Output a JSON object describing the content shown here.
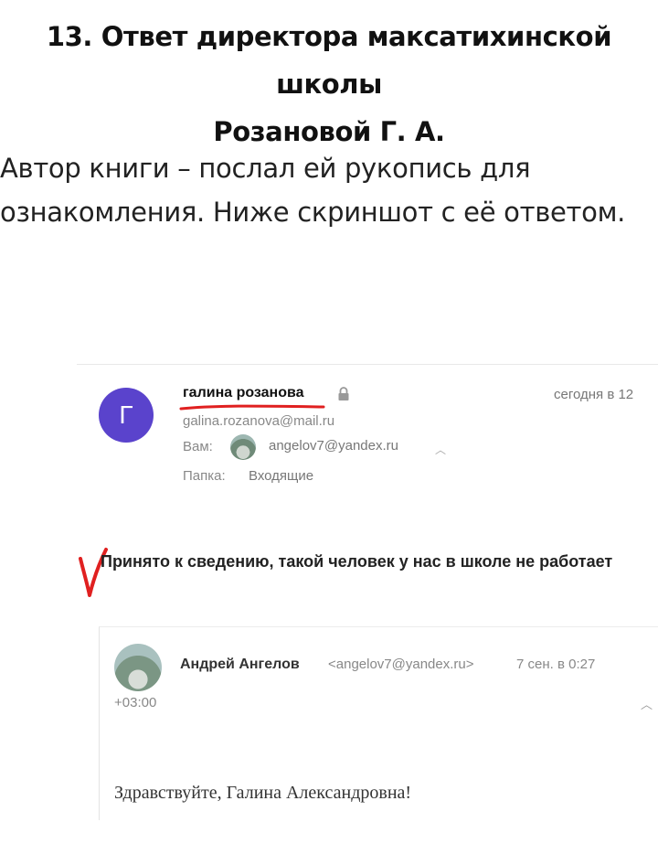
{
  "article": {
    "title_line1": "13. Ответ директора максатихинской школы",
    "title_line2": "Розановой Г. А.",
    "intro_line1": "Автор книги – послал ей рукопись для",
    "intro_line2": "ознакомления. Ниже скриншот с её ответом."
  },
  "email": {
    "avatar_letter": "Г",
    "avatar_color": "#5a43cc",
    "sender_name": "галина розанова",
    "sender_email": "galina.rozanova@mail.ru",
    "date": "сегодня в 12",
    "to_label": "Вам:",
    "to_email": "angelov7@yandex.ru",
    "folder_label": "Папка:",
    "folder_value": "Входящие",
    "reply_text": "Принято к сведению, такой человек у нас в школе не работает",
    "annotation_color": "#e02020",
    "icons": [
      "lock-icon",
      "chevron-up-icon"
    ]
  },
  "quoted": {
    "name": "Андрей Ангелов",
    "email": "<angelov7@yandex.ru>",
    "date": "7 сен. в 0:27",
    "timezone": "+03:00",
    "body": "Здравствуйте, Галина Александровна!"
  }
}
